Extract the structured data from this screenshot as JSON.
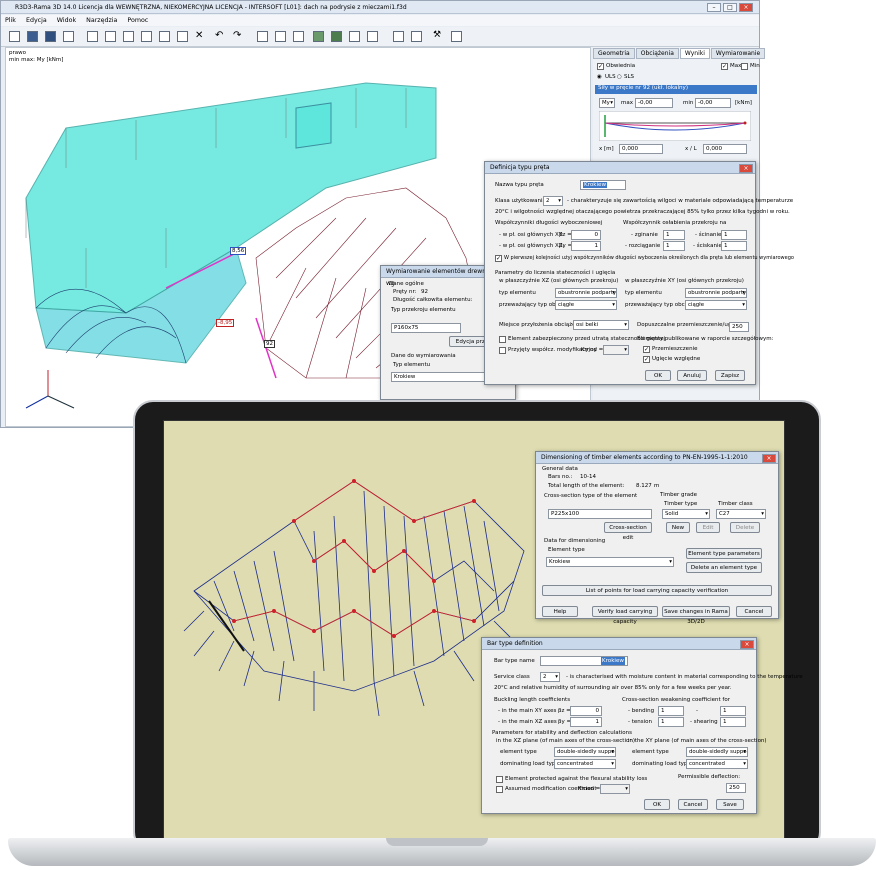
{
  "top_window": {
    "title": "R3D3-Rama 3D 14.0 Licencja dla WEWNĘTRZNA, NIEKOMERCYJNA LICENCJA - INTERSOFT [L01]: dach na podrysie z mieczami1.f3d",
    "menu": [
      "Plik",
      "Edycja",
      "Widok",
      "Narzędzia",
      "Pomoc"
    ],
    "viewport": {
      "view_label": "prawo",
      "result_label": "min max: My [kNm]",
      "value_labels": [
        "8,56",
        "-8,95",
        "92"
      ]
    },
    "side_panel": {
      "tabs": [
        "Geometria",
        "Obciążenia",
        "Wyniki",
        "Wymiarowanie"
      ],
      "active_tab": "Wyniki",
      "obwiednia_label": "Obwiednia",
      "max_label": "Max",
      "min_label": "Min",
      "uls_label": "ULS",
      "sls_label": "SLS",
      "forces_header": "Siły w pręcie nr 92 (ukł. lokalny)",
      "force_symbol": "My",
      "max_text": "max",
      "max_value": "-0,00",
      "min_text": "min",
      "min_value": "-0,00",
      "unit": "[kNm]",
      "x_label": "x [m]",
      "x_value": "0,000",
      "xl_label": "x / L",
      "xl_value": "0,000"
    },
    "wymiarowanie_dialog": {
      "title": "Wymiarowanie elementów drewnianych wg",
      "general": "Dane ogólne",
      "bar_no_label": "Pręty nr:",
      "bar_no": "92",
      "length_label": "Długość całkowita elementu:",
      "section_label": "Typ przekroju elementu",
      "section_value": "P160x75",
      "edit_button": "Edycja przekroju",
      "dim_label": "Dane do wymiarowania",
      "elem_type_label": "Typ elementu",
      "elem_type_value": "Krokiew"
    },
    "def_dialog": {
      "title": "Definicja typu pręta",
      "name_label": "Nazwa typu pręta",
      "name_value": "Krokiew",
      "class_label": "Klasa użytkowania",
      "class_value": "2",
      "class_desc": "- charakteryzuje się zawartością wilgoci w materiale odpowiadającą temperaturze",
      "class_desc2": "20°C i wilgotności względnej otaczającego powietrza przekraczającej 85% tylko przez kilka tygodni w roku.",
      "buckling_header": "Współczynniki długości wyboczeniowej",
      "weaken_header": "Współczynnik osłabienia przekroju na",
      "xy_label": "- w pł. osi głównych XY:",
      "xz_label": "- w pł. osi głównych XZ:",
      "bz_label": "βz =",
      "bz_value": "0",
      "by_label": "βy =",
      "by_value": "1",
      "zginanie": "- zginanie",
      "zginanie_v": "1",
      "scinanie": "- ścinanie",
      "scinanie_v": "1",
      "rozciaganie": "- rozciąganie",
      "rozciaganie_v": "1",
      "sciskanie": "- ściskanie",
      "sciskanie_v": "1",
      "first_check": "W pierwszej kolejności użyj współczynników długości wyboczenia określonych dla pręta lub elementu wymiarowego",
      "stability_header": "Parametry do liczenia stateczności i ugięcia",
      "xz_plane": "w płaszczyźnie XZ (osi głównych przekroju)",
      "xy_plane": "w płaszczyźnie XY (osi głównych przekroju)",
      "type_label": "typ elementu",
      "type_value": "obustronnie podparty",
      "load_label": "przeważający typ obc.",
      "load_value": "ciągłe",
      "place_label": "Miejsce przyłożenia obciążenia",
      "place_value": "osi belki",
      "deflection_label": "Dopuszczalne przemieszczenie/ugięcie:",
      "deflection_value": "250",
      "protected_label": "Element zabezpieczony przed utratą stateczności giętnej",
      "kmod_check": "Przyjęty współcz. modyfikacyjny",
      "kmod_label": "Kmod =",
      "report_label": "Elementy publikowane w raporcie szczegółowym:",
      "przemieszczenie": "Przemieszczenie",
      "ugiecie": "Ugięcie względne",
      "ok": "OK",
      "cancel": "Anuluj",
      "save": "Zapisz"
    }
  },
  "laptop": {
    "dim_dialog": {
      "title": "Dimensioning of timber elements according to PN-EN-1995-1-1:2010",
      "general": "General data",
      "bars_label": "Bars no.:",
      "bars_value": "10-14",
      "total_len_label": "Total length of the element:",
      "total_len_value": "8.127",
      "total_len_unit": "m",
      "cs_label": "Cross-section type of the element",
      "cs_value": "P225x100",
      "cs_edit": "Cross-section edit",
      "timber_grade": "Timber grade",
      "timber_type": "Timber type",
      "timber_class": "Timber class",
      "timber_type_value": "Solid",
      "timber_class_value": "C27",
      "new": "New",
      "edit": "Edit",
      "delete": "Delete",
      "data_dim": "Data for dimensioning",
      "element_type": "Element type",
      "element_type_value": "Krokiew",
      "etp_button": "Element type parameters",
      "del_elem_button": "Delete an element type",
      "points_button": "List of points for load carrying capacity verification",
      "help": "Help",
      "verify": "Verify load carrying capacity",
      "save_changes": "Save changes in Rama 3D/2D",
      "cancel": "Cancel"
    },
    "bar_dialog": {
      "title": "Bar type definition",
      "name_label": "Bar type name",
      "name_value": "Krokiew",
      "service_label": "Service class",
      "service_value": "2",
      "service_desc": "- is characterised with moisture content in material corresponding to the temperature",
      "service_desc2": "20°C and relative humidity of surrounding air over 85% only for a few weeks per year.",
      "buckling_header": "Buckling length coefficients",
      "weaken_header": "Cross-section weakening coefficient for",
      "xy_label": "- in the main XY axes",
      "xz_label": "- in the main XZ axes",
      "bz_label": "βz =",
      "bz_value": "0",
      "by_label": "βy =",
      "by_value": "1",
      "bending": "- bending",
      "bending_v": "1",
      "tension": "- tension",
      "tension_v": "1",
      "shearing": "- shearing",
      "shearing_v": "1",
      "dash": "-",
      "compression_v": "1",
      "stability_header": "Parameters for stability and deflection calculations",
      "xz_plane": "in the XZ plane (of main axes of the cross-section)",
      "xy_plane": "in the XY plane (of main axes of the cross-section)",
      "elem_type_label": "element type",
      "elem_type_value": "double-sidedly supported",
      "load_label": "dominating load type",
      "load_value": "concentrated",
      "perm_label": "Permissible deflection:",
      "perm_value": "250",
      "protected": "Element protected against the flexural stability loss",
      "kmod_check": "Assumed modification coefficient",
      "kmod_label": "Kmod =",
      "ok": "OK",
      "cancel": "Cancel",
      "save": "Save"
    }
  }
}
